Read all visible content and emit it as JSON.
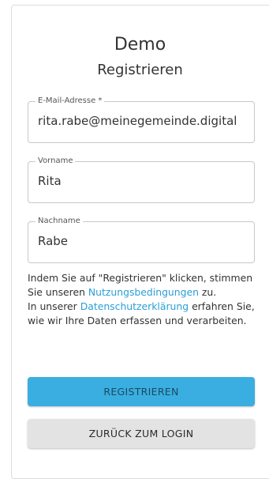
{
  "header": {
    "app_name": "Demo",
    "page_title": "Registrieren"
  },
  "form": {
    "email": {
      "label": "E-Mail-Adresse *",
      "value": "rita.rabe@meinegemeinde.digital"
    },
    "firstname": {
      "label": "Vorname",
      "value": "Rita"
    },
    "lastname": {
      "label": "Nachname",
      "value": "Rabe"
    }
  },
  "legal": {
    "part1": "Indem Sie auf \"Registrieren\" klicken, stimmen Sie unseren ",
    "terms_link": "Nutzungsbedingungen",
    "part2": " zu.",
    "part3": "In unserer ",
    "privacy_link": "Datenschutzerklärung",
    "part4": " erfahren Sie, wie wir Ihre Daten erfassen und verarbeiten."
  },
  "buttons": {
    "register": "REGISTRIEREN",
    "back_to_login": "ZURÜCK ZUM LOGIN"
  },
  "colors": {
    "accent": "#3aaee0",
    "link": "#2a9fd6",
    "secondary_button": "#e3e3e3"
  }
}
